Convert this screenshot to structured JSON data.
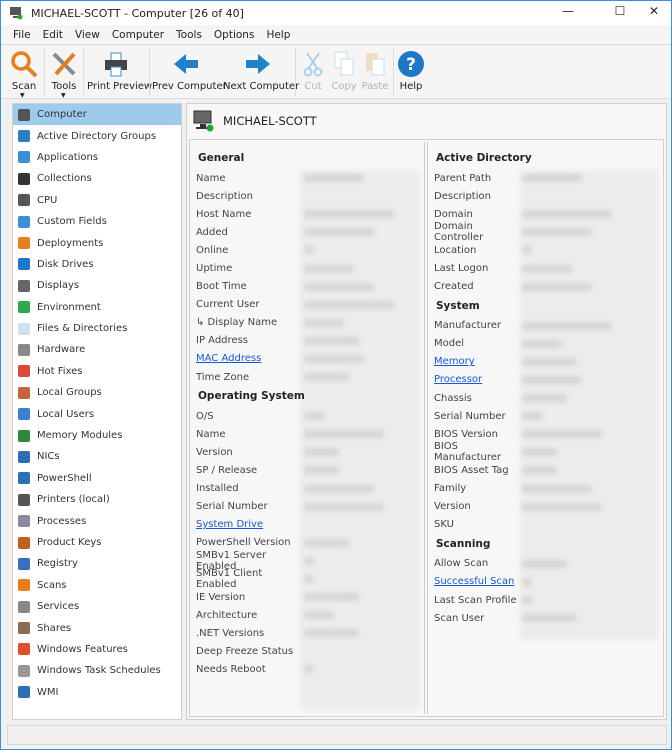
{
  "window": {
    "title": "MICHAEL-SCOTT - Computer [26 of 40]",
    "minimize": "—",
    "maximize": "☐",
    "close": "✕"
  },
  "menu": [
    "File",
    "Edit",
    "View",
    "Computer",
    "Tools",
    "Options",
    "Help"
  ],
  "toolbar": {
    "scan": "Scan",
    "tools": "Tools",
    "print_preview": "Print Preview",
    "prev": "Prev Computer",
    "next": "Next Computer",
    "cut": "Cut",
    "copy": "Copy",
    "paste": "Paste",
    "help": "Help"
  },
  "sidebar": {
    "items": [
      {
        "label": "Computer",
        "icon": "computer-icon",
        "color": "#555"
      },
      {
        "label": "Active Directory Groups",
        "icon": "ad-groups-icon",
        "color": "#2d7fc1"
      },
      {
        "label": "Applications",
        "icon": "applications-icon",
        "color": "#3a8fd8"
      },
      {
        "label": "Collections",
        "icon": "collections-icon",
        "color": "#333"
      },
      {
        "label": "CPU",
        "icon": "cpu-icon",
        "color": "#555"
      },
      {
        "label": "Custom Fields",
        "icon": "custom-fields-icon",
        "color": "#3a8fd8"
      },
      {
        "label": "Deployments",
        "icon": "deployments-icon",
        "color": "#e87d1e"
      },
      {
        "label": "Disk Drives",
        "icon": "disk-drives-icon",
        "color": "#1e78c8"
      },
      {
        "label": "Displays",
        "icon": "displays-icon",
        "color": "#666"
      },
      {
        "label": "Environment",
        "icon": "environment-icon",
        "color": "#2ea84a"
      },
      {
        "label": "Files & Directories",
        "icon": "file-icon",
        "color": "#cfe0f0"
      },
      {
        "label": "Hardware",
        "icon": "wrench-icon",
        "color": "#888"
      },
      {
        "label": "Hot Fixes",
        "icon": "hot-fixes-icon",
        "color": "#d84b3a"
      },
      {
        "label": "Local Groups",
        "icon": "local-groups-icon",
        "color": "#c8643c"
      },
      {
        "label": "Local Users",
        "icon": "local-users-icon",
        "color": "#3a7fd0"
      },
      {
        "label": "Memory Modules",
        "icon": "memory-icon",
        "color": "#2a8a3a"
      },
      {
        "label": "NICs",
        "icon": "nic-icon",
        "color": "#2c6fb5"
      },
      {
        "label": "PowerShell",
        "icon": "powershell-icon",
        "color": "#2c6fb5"
      },
      {
        "label": "Printers (local)",
        "icon": "printer-icon",
        "color": "#555"
      },
      {
        "label": "Processes",
        "icon": "processes-icon",
        "color": "#8a8aa0"
      },
      {
        "label": "Product Keys",
        "icon": "product-keys-icon",
        "color": "#c06020"
      },
      {
        "label": "Registry",
        "icon": "registry-icon",
        "color": "#3a6fc0"
      },
      {
        "label": "Scans",
        "icon": "search-icon",
        "color": "#e87d1e"
      },
      {
        "label": "Services",
        "icon": "gears-icon",
        "color": "#888"
      },
      {
        "label": "Shares",
        "icon": "shares-icon",
        "color": "#8a6a50"
      },
      {
        "label": "Windows Features",
        "icon": "windows-icon",
        "color": "#e0502a"
      },
      {
        "label": "Windows Task Schedules",
        "icon": "calendar-icon",
        "color": "#999"
      },
      {
        "label": "WMI",
        "icon": "wmi-icon",
        "color": "#2c6fb5"
      }
    ]
  },
  "header": {
    "title": "MICHAEL-SCOTT"
  },
  "left_sections": [
    {
      "title": "General",
      "fields": [
        {
          "label": "Name"
        },
        {
          "label": "Description"
        },
        {
          "label": "Host Name"
        },
        {
          "label": "Added"
        },
        {
          "label": "Online"
        },
        {
          "label": "Uptime"
        },
        {
          "label": "Boot Time"
        },
        {
          "label": "Current User"
        },
        {
          "label": "↳ Display Name"
        },
        {
          "label": "IP Address"
        },
        {
          "label": "MAC Address",
          "link": true
        },
        {
          "label": "Time Zone"
        }
      ]
    },
    {
      "title": "Operating System",
      "fields": [
        {
          "label": "O/S"
        },
        {
          "label": "Name"
        },
        {
          "label": "Version"
        },
        {
          "label": "SP / Release"
        },
        {
          "label": "Installed"
        },
        {
          "label": "Serial Number"
        },
        {
          "label": "System Drive",
          "link": true
        },
        {
          "label": "PowerShell Version"
        },
        {
          "label": "SMBv1 Server Enabled"
        },
        {
          "label": "SMBv1 Client Enabled"
        },
        {
          "label": "IE Version"
        },
        {
          "label": "Architecture"
        },
        {
          "label": ".NET Versions"
        },
        {
          "label": "Deep Freeze Status"
        },
        {
          "label": "Needs Reboot"
        }
      ]
    }
  ],
  "right_sections": [
    {
      "title": "Active Directory",
      "fields": [
        {
          "label": "Parent Path"
        },
        {
          "label": "Description"
        },
        {
          "label": "Domain"
        },
        {
          "label": "Domain Controller"
        },
        {
          "label": "Location"
        },
        {
          "label": "Last Logon"
        },
        {
          "label": "Created"
        }
      ]
    },
    {
      "title": "System",
      "fields": [
        {
          "label": "Manufacturer"
        },
        {
          "label": "Model"
        },
        {
          "label": "Memory",
          "link": true
        },
        {
          "label": "Processor",
          "link": true
        },
        {
          "label": "Chassis"
        },
        {
          "label": "Serial Number"
        },
        {
          "label": "BIOS Version"
        },
        {
          "label": "BIOS Manufacturer"
        },
        {
          "label": "BIOS Asset Tag"
        },
        {
          "label": "Family"
        },
        {
          "label": "Version"
        },
        {
          "label": "SKU"
        }
      ]
    },
    {
      "title": "Scanning",
      "fields": [
        {
          "label": "Allow Scan"
        },
        {
          "label": "Successful Scan",
          "link": true
        },
        {
          "label": "Last Scan Profile"
        },
        {
          "label": "Scan User"
        }
      ]
    }
  ]
}
